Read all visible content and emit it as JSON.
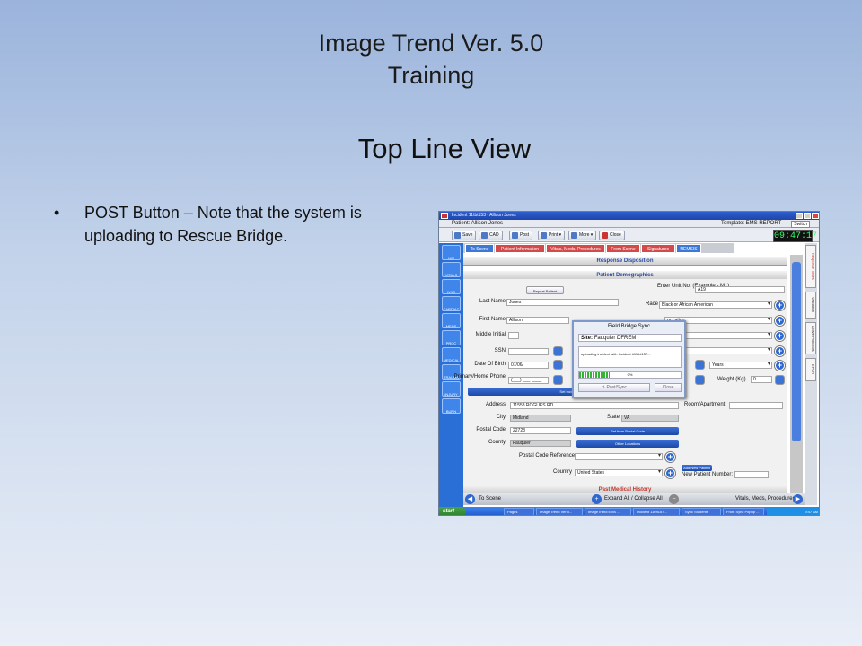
{
  "slide": {
    "title_line1": "Image Trend Ver. 5.0",
    "title_line2": "Training",
    "subtitle": "Top Line View",
    "bullet": "POST Button – Note that the system is uploading to Rescue Bridge."
  },
  "app": {
    "window_title": "Incident 11tbt153 - Allison Jones",
    "patient_line": "Patient: Allison Jones",
    "template": "Template: EMS REPORT",
    "switch_label": "Switch",
    "clock": "09:47:17",
    "toolbar": {
      "save": "Save",
      "cad": "CAD",
      "post": "Post",
      "print": "Print ▾",
      "more": "More ▾",
      "close": "Close"
    },
    "left_nav": [
      "NOI",
      "VITALS",
      "IV/IO",
      "CARDIAC",
      "MEDS",
      "PROC",
      "MEDICAL",
      "TRAUMA",
      "INJURY",
      "BURN"
    ],
    "tabs": [
      "To Scene",
      "Patient Information",
      "Vitals, Meds, Procedures",
      "From Scene",
      "Signatures",
      "NEMSIS"
    ],
    "sections": {
      "response": "Response Disposition",
      "demographics": "Patient Demographics",
      "history": "Past Medical History"
    },
    "right_tabs": [
      "Response Times",
      "Validation",
      "Active Protocols",
      "EPCR"
    ],
    "form": {
      "repeat_patient": "Repeat Patient",
      "last_name_label": "Last Name",
      "last_name": "Jones",
      "first_name_label": "First Name",
      "first_name": "Allison",
      "middle_initial_label": "Middle Initial",
      "ssn_label": "SSN",
      "dob_label": "Date Of Birth",
      "dob": "07/06/",
      "phone_label": "Primary/Home Phone",
      "phone": "(___) ___-____",
      "set_incident": "Set Incid",
      "unit_label": "Enter Unit No. (Example - M1)",
      "unit": "A19",
      "race_label": "Race",
      "race": "Black or African American",
      "ethnicity": "or Latino",
      "age_units": "Years",
      "weight_label": "Weight (Kg)",
      "weight": "0",
      "address_label": "Address",
      "address": "11558 ROGUES RD",
      "room_label": "Room/Apartment",
      "city_label": "City",
      "city": "Midland",
      "state_label": "State",
      "state": "VA",
      "postal_label": "Postal Code",
      "postal": "22728",
      "set_from_postal": "Set from Postal Code",
      "county_label": "County",
      "county": "Fauquier",
      "other_locations": "Other Locations",
      "postal_ref_label": "Postal Code Reference",
      "country_label": "Country",
      "country": "United States",
      "add_new_patient": "Add New Patient",
      "new_patient_number_label": "New Patient Number:"
    },
    "bottom": {
      "to_scene": "To Scene",
      "expand": "Expand All / Collapse All",
      "vitals": "Vitals, Meds, Procedures"
    },
    "dialog": {
      "title": "Field Bridge Sync",
      "site_label": "Site:",
      "site": "Fauquier DFREM",
      "message": "uploading incident with Incident #11tbt157...",
      "progress_percent": 0,
      "progress_text": "0%",
      "post_sync": "Post/Sync",
      "close": "Close"
    },
    "taskbar": {
      "start": "start",
      "items": [
        "Pages",
        "Image Trend Ver 5...",
        "ImageTrend EMS ...",
        "Incident 11tbt157...",
        "Sync Students",
        "From Sync Popup ..."
      ],
      "clock": "9:47 AM"
    }
  }
}
